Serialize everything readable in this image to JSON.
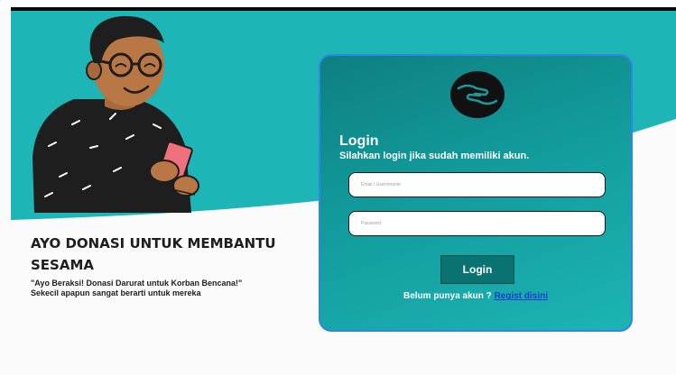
{
  "hero": {
    "title": "AYO DONASI UNTUK MEMBANTU SESAMA",
    "tagline_line1": "\"Ayo Beraksi! Donasi Darurat untuk Korban Bencana!\"",
    "tagline_line2": "Sekecil apapun sangat berarti untuk mereka",
    "illustration": "man-holding-phone-illustration"
  },
  "login": {
    "logo_icon": "hands-giving-logo",
    "title": "Login",
    "subtitle": "Silahkan login jika sudah memiliki akun.",
    "email_placeholder": "Email / Usermname",
    "email_value": "",
    "password_placeholder": "Password",
    "password_value": "",
    "button_label": "Login",
    "register_prompt": "Belum punya akun ? ",
    "register_link": "Regist disini"
  },
  "colors": {
    "teal_background": "#1db5b5",
    "card_gradient_start": "#0e7f80",
    "card_border": "#2f86e6",
    "button_background": "#0b7272",
    "link": "#1a3cd6",
    "text_dark": "#1e1e1e"
  }
}
